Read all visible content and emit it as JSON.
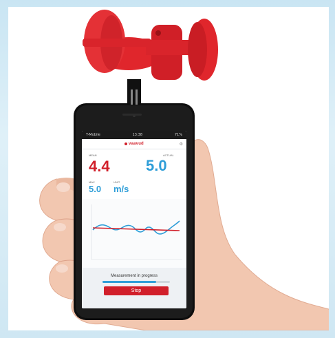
{
  "status_bar": {
    "carrier": "T-Mobile",
    "time": "13:38",
    "battery": "71%"
  },
  "app": {
    "brand": "vaavud",
    "settings_icon": "gear-icon"
  },
  "readings": {
    "mean_label": "MEAN",
    "mean_value": "4.4",
    "actual_label": "ACTUAL",
    "actual_value": "5.0",
    "max_label": "MAX",
    "max_value": "5.0",
    "unit_label": "UNIT",
    "unit_value": "m/s"
  },
  "footer": {
    "progress_text": "Measurement in progress",
    "progress_fraction": 0.8,
    "stop_label": "Stop"
  },
  "colors": {
    "accent_red": "#d11f2a",
    "accent_blue": "#2f9ed8",
    "anemometer_red": "#e0262c",
    "frame_blue": "#cfe7f3"
  }
}
